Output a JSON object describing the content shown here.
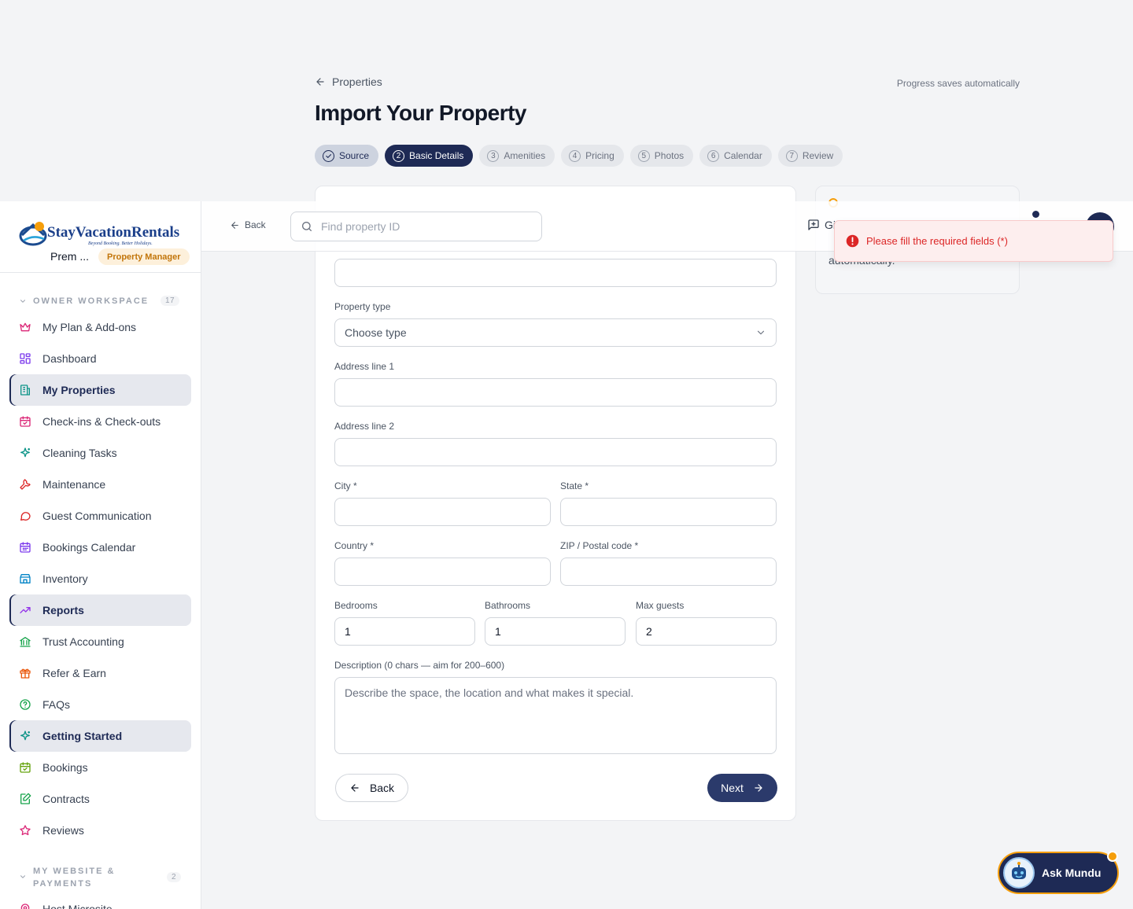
{
  "page": {
    "breadcrumb": "Properties",
    "progress_note": "Progress saves automatically",
    "title": "Import Your Property"
  },
  "steps": [
    {
      "num": "✓",
      "label": "Source",
      "state": "done"
    },
    {
      "num": "2",
      "label": "Basic Details",
      "state": "active"
    },
    {
      "num": "3",
      "label": "Amenities",
      "state": "todo"
    },
    {
      "num": "4",
      "label": "Pricing",
      "state": "todo"
    },
    {
      "num": "5",
      "label": "Photos",
      "state": "todo"
    },
    {
      "num": "6",
      "label": "Calendar",
      "state": "todo"
    },
    {
      "num": "7",
      "label": "Review",
      "state": "todo"
    }
  ],
  "form": {
    "name_value": "",
    "type_label": "Property type",
    "type_value": "Choose type",
    "address1_label": "Address line 1",
    "address1_value": "",
    "address2_label": "Address line 2",
    "address2_value": "",
    "city_label": "City *",
    "city_value": "",
    "state_label": "State *",
    "state_value": "",
    "country_label": "Country *",
    "country_value": "",
    "zip_label": "ZIP / Postal code *",
    "zip_value": "",
    "bedrooms_label": "Bedrooms",
    "bedrooms_value": "1",
    "bathrooms_label": "Bathrooms",
    "bathrooms_value": "1",
    "guests_label": "Max guests",
    "guests_value": "2",
    "description_label": "Description (0 chars — aim for 200–600)",
    "description_placeholder": "Describe the space, the location and what makes it special.",
    "back_label": "Back",
    "next_label": "Next"
  },
  "side_card": {
    "text": "automatically."
  },
  "topbar": {
    "back_label": "Back",
    "search_placeholder": "Find property ID",
    "chat_label": "Gi"
  },
  "toast": {
    "message": "Please fill the required fields (*)"
  },
  "sidebar": {
    "brand": "StayVacationRentals",
    "user": "Prem ...",
    "role": "Property Manager",
    "section1": {
      "title": "OWNER WORKSPACE",
      "count": "17"
    },
    "items": [
      {
        "label": "My Plan & Add-ons",
        "icon": "crown-icon"
      },
      {
        "label": "Dashboard",
        "icon": "dashboard-icon"
      },
      {
        "label": "My Properties",
        "icon": "building-icon"
      },
      {
        "label": "Check-ins & Check-outs",
        "icon": "calendar-check-icon"
      },
      {
        "label": "Cleaning Tasks",
        "icon": "sparkles-icon"
      },
      {
        "label": "Maintenance",
        "icon": "wrench-icon"
      },
      {
        "label": "Guest Communication",
        "icon": "chat-icon"
      },
      {
        "label": "Bookings Calendar",
        "icon": "calendar-icon"
      },
      {
        "label": "Inventory",
        "icon": "store-icon"
      },
      {
        "label": "Reports",
        "icon": "trending-up-icon"
      },
      {
        "label": "Trust Accounting",
        "icon": "bank-icon"
      },
      {
        "label": "Refer & Earn",
        "icon": "gift-icon"
      },
      {
        "label": "FAQs",
        "icon": "help-circle-icon"
      },
      {
        "label": "Getting Started",
        "icon": "sparkles-icon"
      },
      {
        "label": "Bookings",
        "icon": "calendar-check-icon"
      },
      {
        "label": "Contracts",
        "icon": "file-edit-icon"
      },
      {
        "label": "Reviews",
        "icon": "star-icon"
      }
    ],
    "section2": {
      "title": "MY WEBSITE &",
      "title2": "PAYMENTS",
      "count": "2"
    },
    "partial_item": "Host Microsite"
  },
  "assistant": {
    "label": "Ask Mundu"
  },
  "colors": {
    "brand_navy": "#1e2a55",
    "accent_orange": "#f59e0b",
    "error_red": "#dc2626"
  }
}
